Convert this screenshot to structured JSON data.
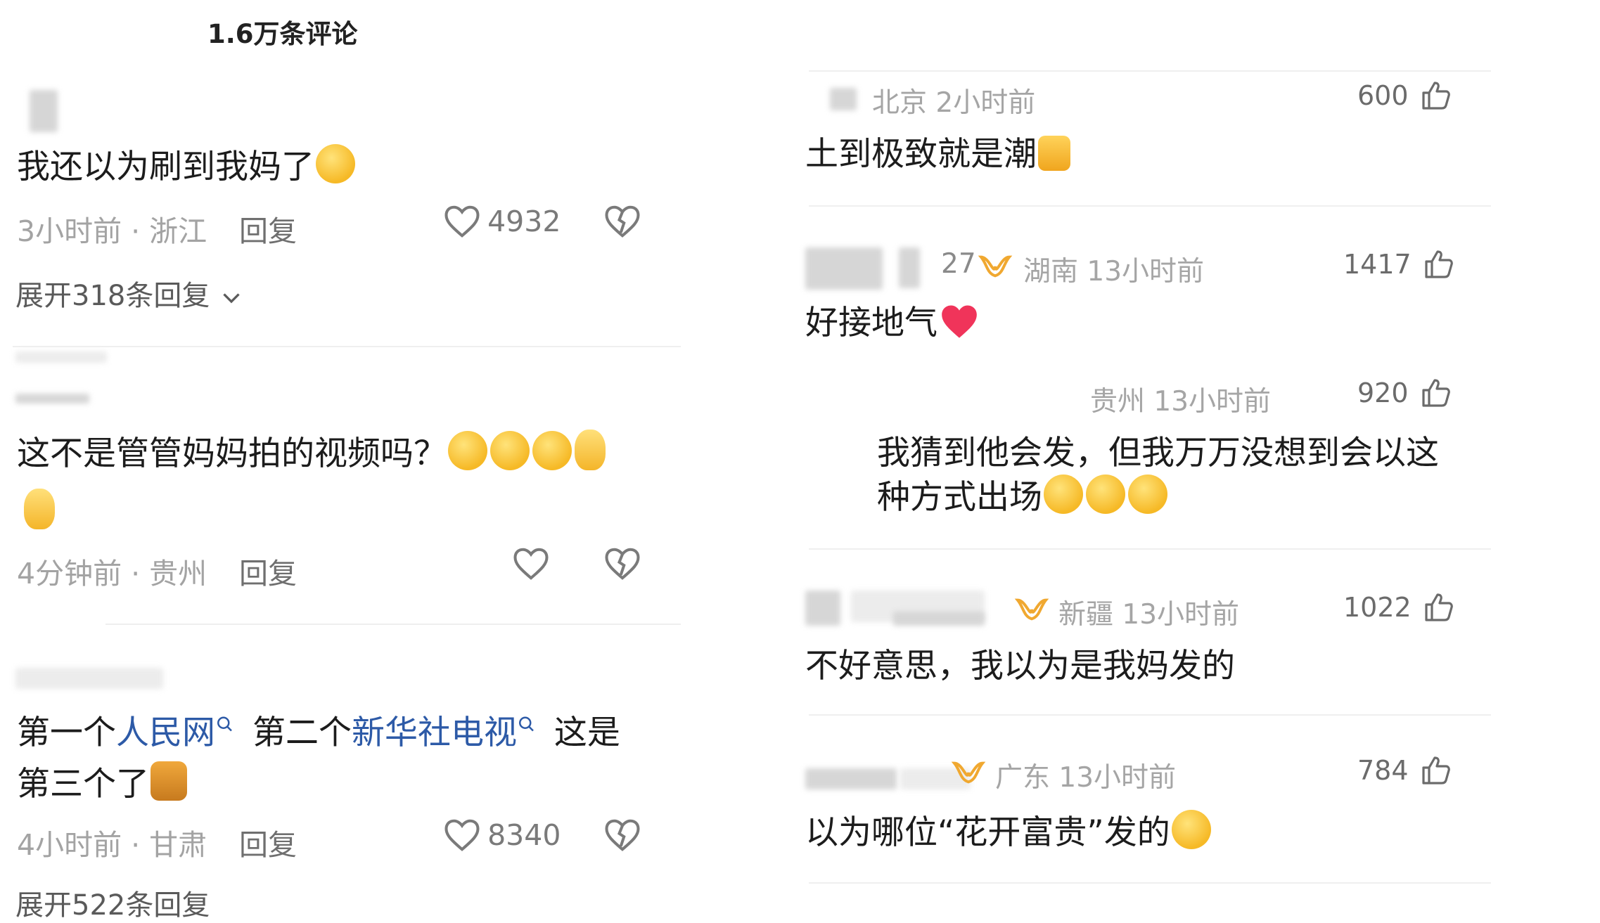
{
  "left": {
    "title": "1.6万条评论",
    "comments": [
      {
        "text": "我还以为刷到我妈了",
        "time_location": "3小时前 · 浙江",
        "reply_label": "回复",
        "likes": "4932",
        "expand_label": "展开318条回复"
      },
      {
        "text": "这不是管管妈妈拍的视频吗？",
        "time_location": "4分钟前 · 贵州",
        "reply_label": "回复"
      },
      {
        "text_part1": "第一个",
        "link1": "人民网",
        "text_part2": "第二个",
        "link2": "新华社电视",
        "text_part3": "这是",
        "text_line2": "第三个了",
        "time_location": "4小时前 · 甘肃",
        "reply_label": "回复",
        "likes": "8340",
        "expand_label": "展开522条回复"
      }
    ]
  },
  "right": {
    "comments": [
      {
        "name_fragment": "",
        "location_time": "北京 2小时前",
        "likes": "600",
        "text": "土到极致就是潮"
      },
      {
        "name_fragment": "27",
        "location_time": "湖南 13小时前",
        "likes": "1417",
        "text": "好接地气"
      },
      {
        "location_time": "贵州 13小时前",
        "likes": "920",
        "text_line1": "我猜到他会发，但我万万没想到会以这",
        "text_line2": "种方式出场"
      },
      {
        "location_time": "新疆 13小时前",
        "likes": "1022",
        "text": "不好意思，我以为是我妈发的"
      },
      {
        "location_time": "广东 13小时前",
        "likes": "784",
        "text": "以为哪位“花开富贵”发的"
      }
    ]
  },
  "icons": {
    "like": "heart-outline-icon",
    "dislike": "broken-heart-icon",
    "thumb": "thumbs-up-icon",
    "expand": "chevron-down-icon",
    "search": "search-icon",
    "badge": "fan-badge-icon"
  },
  "colors": {
    "link": "#2d5aa7",
    "badge": "#f0a830",
    "heart_emoji": "#f0345a"
  }
}
